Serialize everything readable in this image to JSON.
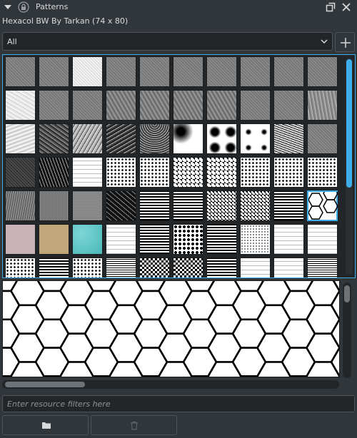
{
  "titlebar": {
    "title": "Patterns",
    "collapse_icon": "triangle-down-icon",
    "lock_icon": "lock-icon",
    "float_icon": "float-icon",
    "close_icon": "close-icon"
  },
  "pattern_info": {
    "name": "Hexacol BW By Tarkan (74 x 80)"
  },
  "filter_dropdown": {
    "selected": "All"
  },
  "add_button": {
    "icon": "plus-icon"
  },
  "pattern_grid": {
    "rows": [
      [
        "gray-noise",
        "gray-noise",
        "light-crosshatch",
        "gray-noise",
        "gray-noise",
        "gray-noise",
        "gray-noise",
        "gray-noise",
        "gray-noise",
        "gray-noise"
      ],
      [
        "white-crumpled",
        "gray-noise",
        "gray-noise",
        "gray-stone",
        "gray-stone",
        "gray-stone",
        "gray-stone",
        "gray-noise",
        "gray-noise",
        "gray-bark"
      ],
      [
        "white-wave",
        "dark-leaves",
        "gray-leaves",
        "dark-waves",
        "dark-scales",
        "radial-blur-dots",
        "radial-dark-dots",
        "star-dots",
        "dark-scribble",
        "gray-noise"
      ],
      [
        "dark-noise",
        "dark-veins",
        "white-grid",
        "dot-grid",
        "dot-grid",
        "diamond-grid",
        "diamond-grid",
        "dot-grid",
        "dot-grid",
        "dot-grid"
      ],
      [
        "gray-scratch",
        "vertical-lines",
        "fine-grid",
        "dark-cracks",
        "dark-grid",
        "dark-grid",
        "dark-diamond",
        "dark-diamond",
        "dark-grid",
        "hexagons"
      ],
      [
        "mauve",
        "tan",
        "teal",
        "white-grid",
        "dark-grid",
        "dark-dots",
        "dark-grid",
        "white-dots",
        "white-grid",
        "white-grid"
      ],
      [
        "dot-grid",
        "dark-grid",
        "dot-grid",
        "stripes",
        "checker",
        "checker",
        "dark-grid",
        "white-grid",
        "white-grid",
        "stripes"
      ]
    ],
    "selected_index": [
      4,
      9
    ]
  },
  "preview": {
    "pattern": "hexagons"
  },
  "resource_filter": {
    "placeholder": "Enter resource filters here"
  },
  "bottom_buttons": {
    "open_icon": "folder-icon",
    "delete_icon": "trash-icon"
  },
  "colors": {
    "background": "#31363b",
    "field": "#232629",
    "accent": "#3daee9",
    "text": "#d6d8da"
  }
}
